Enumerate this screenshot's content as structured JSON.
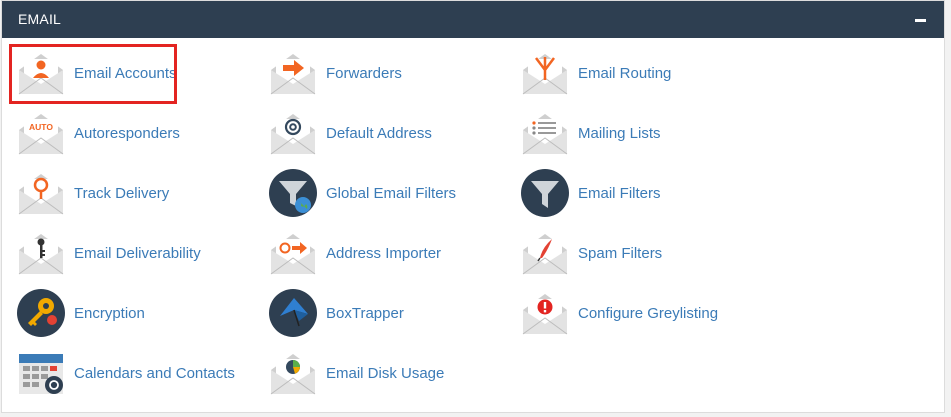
{
  "section": {
    "title": "EMAIL"
  },
  "items": [
    {
      "label": "Email Accounts",
      "icon": "email-accounts-icon"
    },
    {
      "label": "Forwarders",
      "icon": "forwarders-icon"
    },
    {
      "label": "Email Routing",
      "icon": "email-routing-icon"
    },
    {
      "label": "Autoresponders",
      "icon": "autoresponders-icon",
      "badge": "AUTO"
    },
    {
      "label": "Default Address",
      "icon": "default-address-icon"
    },
    {
      "label": "Mailing Lists",
      "icon": "mailing-lists-icon"
    },
    {
      "label": "Track Delivery",
      "icon": "track-delivery-icon"
    },
    {
      "label": "Global Email Filters",
      "icon": "global-email-filters-icon"
    },
    {
      "label": "Email Filters",
      "icon": "email-filters-icon"
    },
    {
      "label": "Email Deliverability",
      "icon": "email-deliverability-icon"
    },
    {
      "label": "Address Importer",
      "icon": "address-importer-icon"
    },
    {
      "label": "Spam Filters",
      "icon": "spam-filters-icon"
    },
    {
      "label": "Encryption",
      "icon": "encryption-icon"
    },
    {
      "label": "BoxTrapper",
      "icon": "boxtrapper-icon"
    },
    {
      "label": "Configure Greylisting",
      "icon": "configure-greylisting-icon"
    },
    {
      "label": "Calendars and Contacts",
      "icon": "calendars-contacts-icon"
    },
    {
      "label": "Email Disk Usage",
      "icon": "email-disk-usage-icon"
    }
  ],
  "colors": {
    "header": "#2e3f51",
    "link": "#3b7bb7",
    "accent": "#f26522",
    "highlight": "#e32421"
  }
}
